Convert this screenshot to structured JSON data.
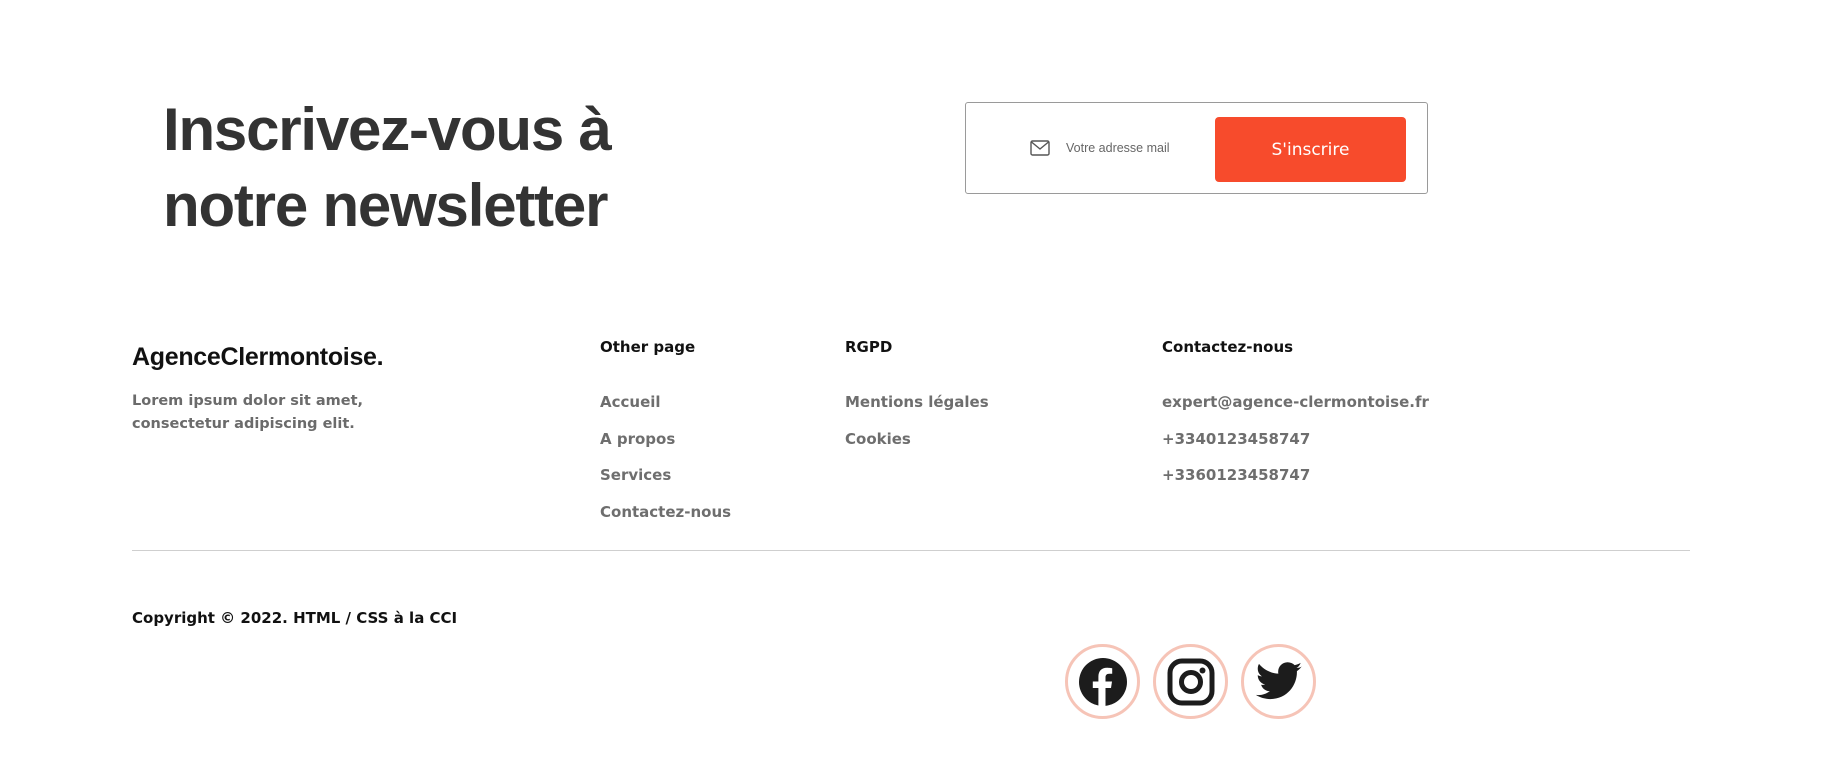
{
  "newsletter": {
    "title_line1": "Inscrivez-vous à",
    "title_line2": "notre newsletter",
    "input_placeholder": "Votre adresse mail",
    "button_label": "S'inscrire",
    "mail_icon": "mail-icon",
    "accent_color": "#f74b2c"
  },
  "footer": {
    "brand": "AgenceClermontoise.",
    "description": "Lorem ipsum dolor sit amet, consectetur adipiscing elit.",
    "columns": [
      {
        "title": "Other page",
        "links": [
          "Accueil",
          "A propos",
          "Services",
          "Contactez-nous"
        ]
      },
      {
        "title": "RGPD",
        "links": [
          "Mentions légales",
          "Cookies"
        ]
      },
      {
        "title": "Contactez-nous",
        "links": [
          "expert@agence-clermontoise.fr",
          "+3340123458747",
          "+3360123458747"
        ]
      }
    ],
    "copyright": "Copyright © 2022. HTML / CSS à la CCI",
    "socials": [
      {
        "name": "Facebook",
        "icon": "facebook-icon"
      },
      {
        "name": "Instagram",
        "icon": "instagram-icon"
      },
      {
        "name": "Twitter",
        "icon": "twitter-icon"
      }
    ],
    "social_ring_color": "#f6c4b7"
  }
}
